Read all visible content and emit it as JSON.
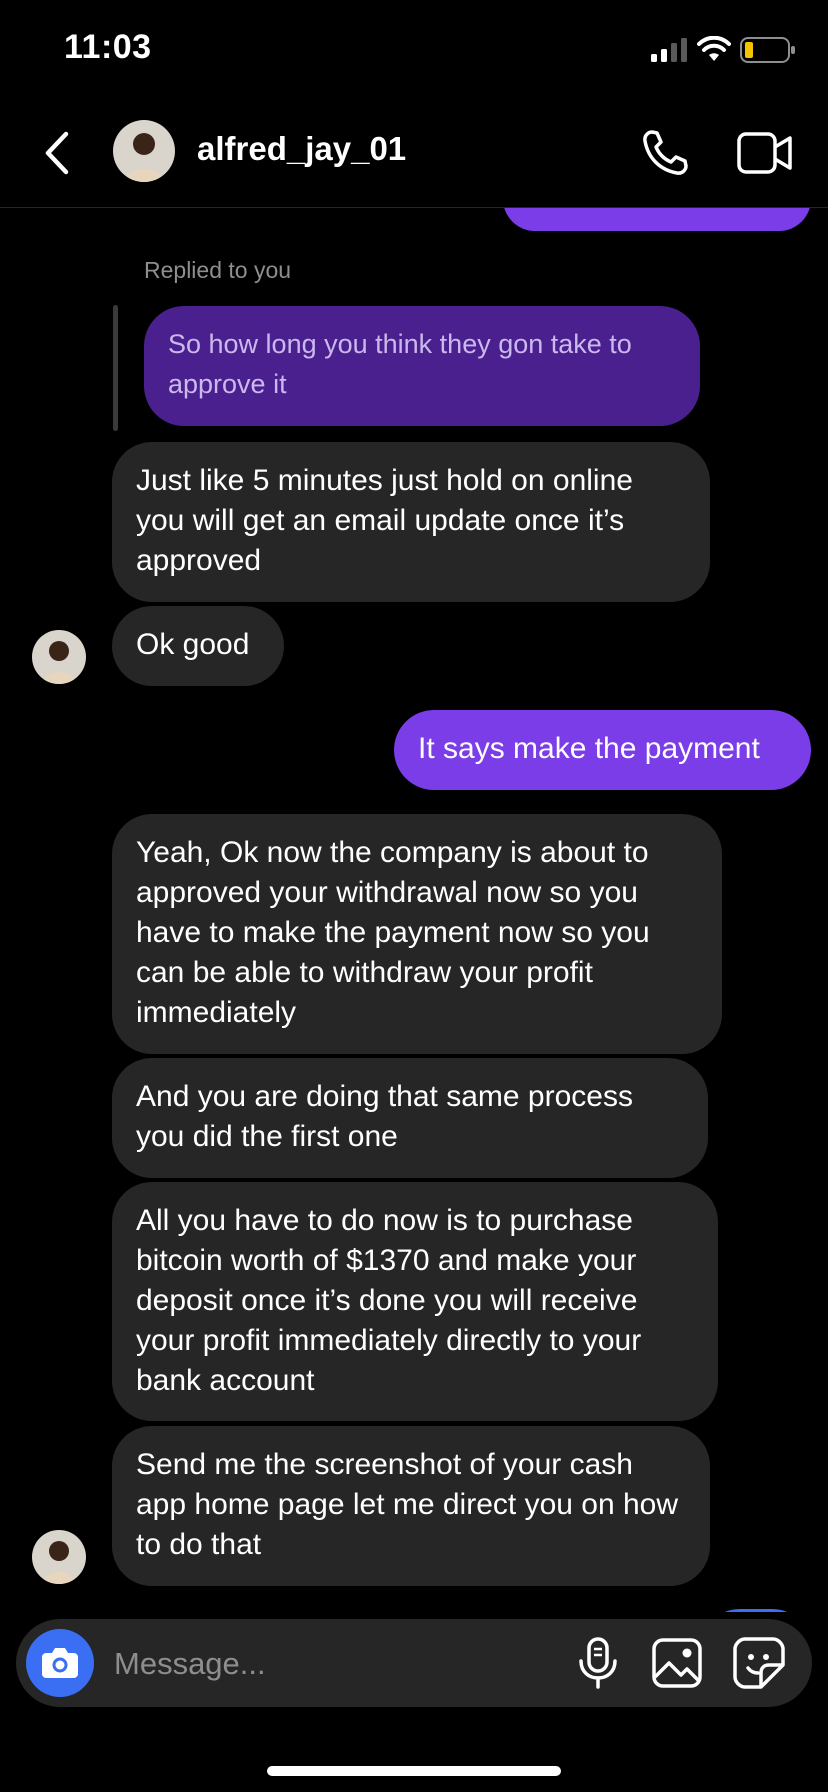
{
  "status_bar": {
    "time": "11:03"
  },
  "header": {
    "contact_name": "alfred_jay_01",
    "icons": [
      "back-icon",
      "avatar",
      "phone-icon",
      "video-icon"
    ]
  },
  "thread": {
    "replied_label": "Replied to you",
    "quoted_message": "So how long you think they gon take to approve it",
    "messages": [
      {
        "direction": "incoming",
        "text": "Just like 5 minutes just hold on online you will get an email update once it’s approved"
      },
      {
        "direction": "incoming",
        "text": "Ok good"
      },
      {
        "direction": "outgoing",
        "text": "It says make the payment"
      },
      {
        "direction": "incoming",
        "text": "Yeah, Ok now  the company is about to approved your withdrawal now so you have to make the payment now so you can be able to withdraw your profit immediately"
      },
      {
        "direction": "incoming",
        "text": "And you are doing that same process you did the first one"
      },
      {
        "direction": "incoming",
        "text": "All you have to do now is to purchase bitcoin worth of $1370 and make your deposit once it’s done you will receive your profit immediately directly to your bank account"
      },
      {
        "direction": "incoming",
        "text": "Send me the screenshot of your cash app home page let me direct you on how to do that"
      }
    ]
  },
  "composer": {
    "placeholder": "Message...",
    "icons": [
      "camera-icon",
      "microphone-icon",
      "gallery-icon",
      "sticker-icon"
    ]
  },
  "colors": {
    "background": "#000000",
    "incoming_bubble": "#262626",
    "outgoing_bubble": "#7a3de8",
    "quoted_bubble": "#4a1f8e",
    "camera_button": "#3b6ff3"
  }
}
